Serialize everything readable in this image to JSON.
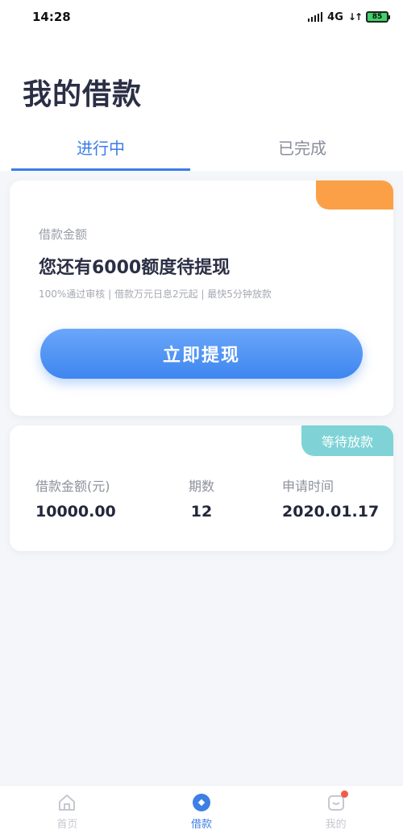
{
  "status_bar": {
    "time": "14:28",
    "network": "4G",
    "battery": "85"
  },
  "header": {
    "title": "我的借款"
  },
  "tabs": [
    {
      "label": "进行中",
      "active": true
    },
    {
      "label": "已完成",
      "active": false
    }
  ],
  "withdraw_card": {
    "label": "借款金额",
    "headline": "您还有6000额度待提现",
    "subtext": "100%通过审核 | 借款万元日息2元起 | 最快5分钟放款",
    "button_label": "立即提现"
  },
  "loan_record": {
    "status": "等待放款",
    "amount_label": "借款金额(元)",
    "amount_value": "10000.00",
    "periods_label": "期数",
    "periods_value": "12",
    "date_label": "申请时间",
    "date_value": "2020.01.17"
  },
  "bottom_nav": [
    {
      "label": "首页",
      "icon": "home-icon",
      "active": false
    },
    {
      "label": "借款",
      "icon": "loan-icon",
      "active": true
    },
    {
      "label": "我的",
      "icon": "mine-icon",
      "active": false,
      "badge": true
    }
  ],
  "colors": {
    "accent": "#3b7de8",
    "orange": "#fba046",
    "teal": "#7fd3d6",
    "badge_red": "#f05a4a"
  }
}
